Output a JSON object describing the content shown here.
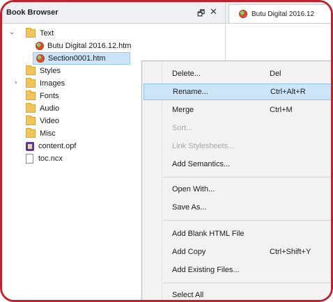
{
  "panel": {
    "title": "Book Browser",
    "float_glyph": "🗗",
    "close_glyph": "✕"
  },
  "tree": {
    "text_folder": "Text",
    "files": [
      "Butu Digital 2016.12.htm",
      "Section0001.htm"
    ],
    "folders": [
      "Styles",
      "Images",
      "Fonts",
      "Audio",
      "Video",
      "Misc"
    ],
    "opf": "content.opf",
    "ncx": "toc.ncx",
    "expanded_glyph": "⌄",
    "collapsed_glyph": "›"
  },
  "editor": {
    "tab_label": "Butu Digital 2016.12"
  },
  "menu": {
    "items": [
      {
        "label": "Delete...",
        "shortcut": "Del"
      },
      {
        "label": "Rename...",
        "shortcut": "Ctrl+Alt+R"
      },
      {
        "label": "Merge",
        "shortcut": "Ctrl+M"
      },
      {
        "label": "Sort...",
        "shortcut": ""
      },
      {
        "label": "Link Stylesheets...",
        "shortcut": ""
      },
      {
        "label": "Add Semantics...",
        "shortcut": ""
      },
      {
        "label": "Open With...",
        "shortcut": ""
      },
      {
        "label": "Save As...",
        "shortcut": ""
      },
      {
        "label": "Add Blank HTML File",
        "shortcut": ""
      },
      {
        "label": "Add Copy",
        "shortcut": "Ctrl+Shift+Y"
      },
      {
        "label": "Add Existing Files...",
        "shortcut": ""
      },
      {
        "label": "Select All",
        "shortcut": ""
      }
    ]
  }
}
